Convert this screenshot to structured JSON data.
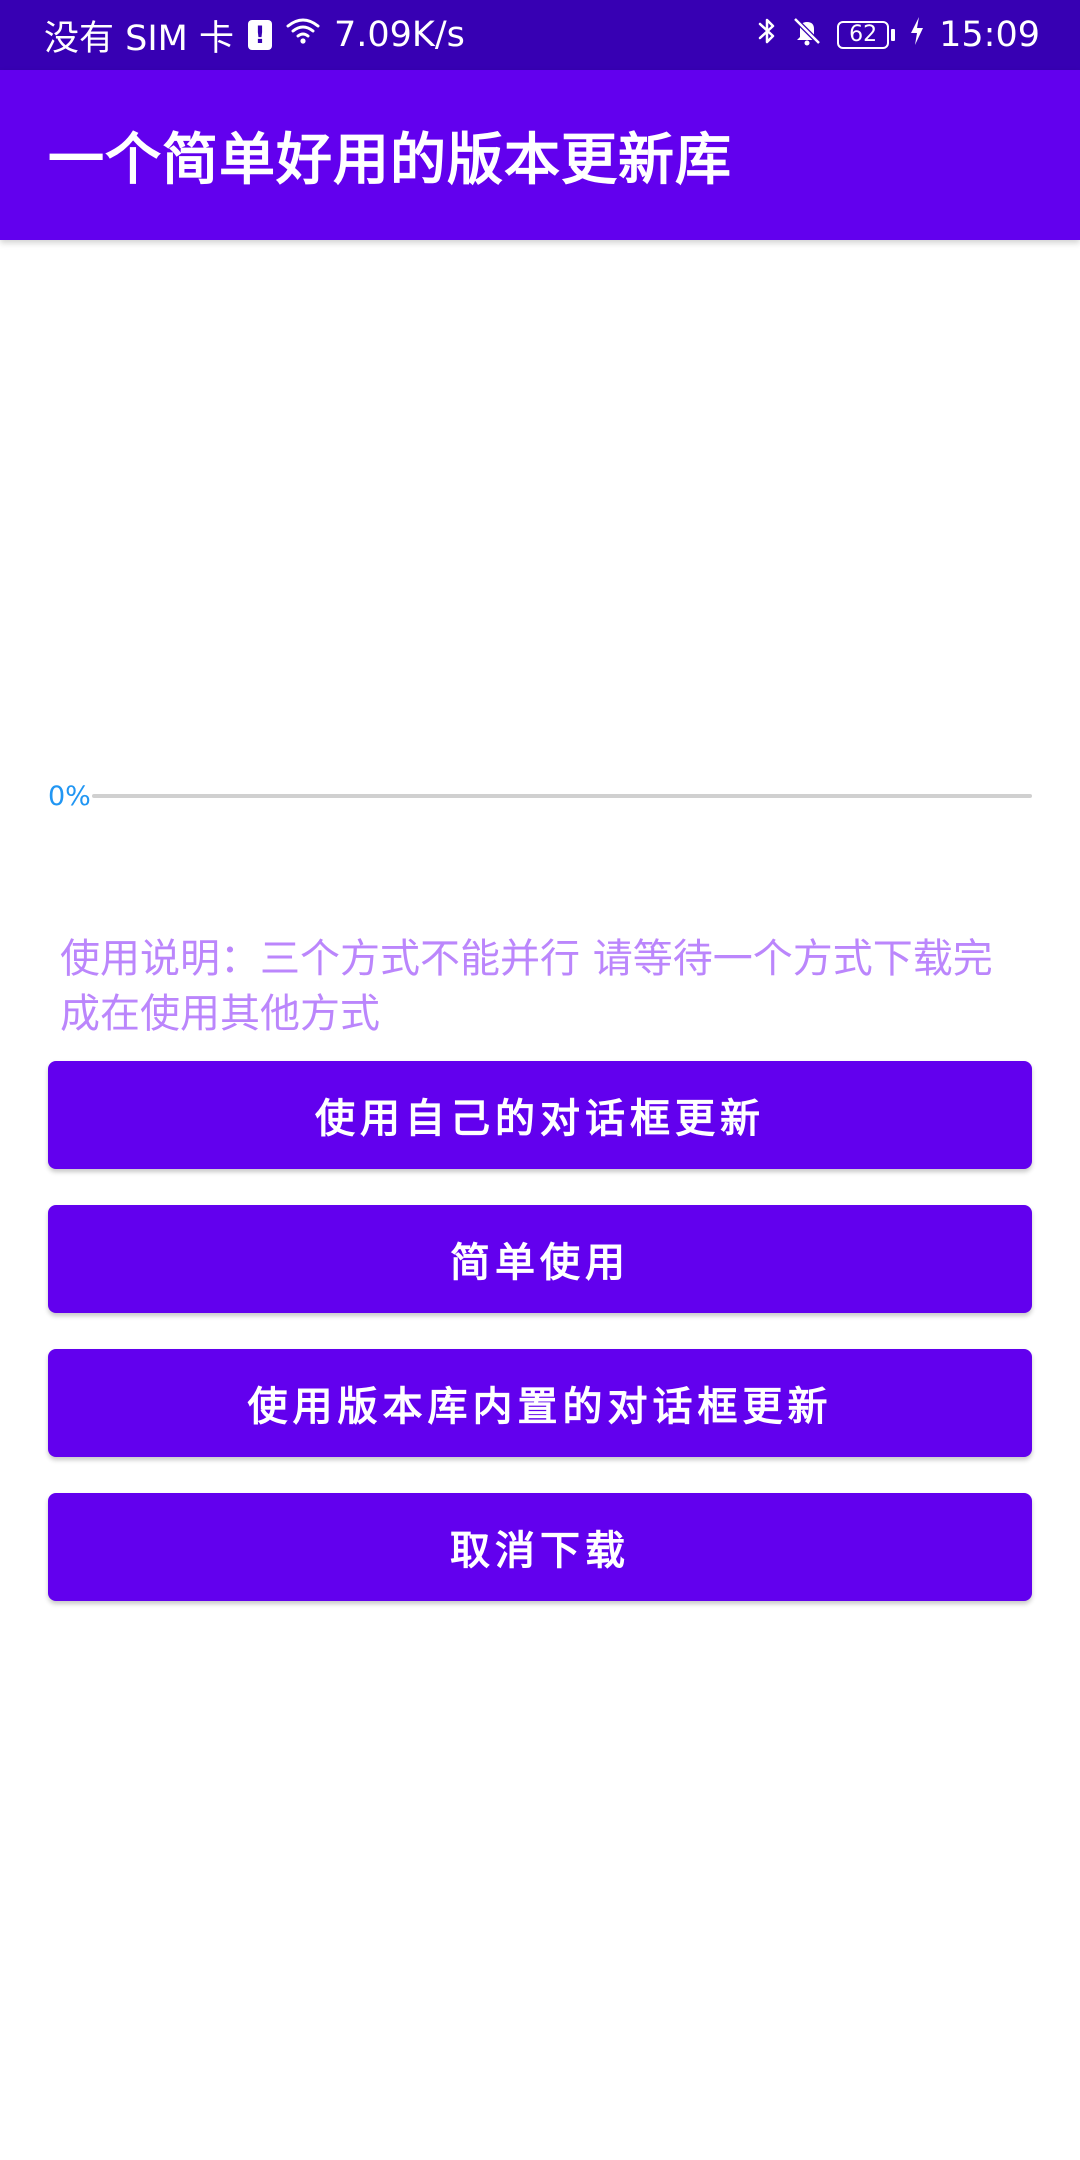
{
  "status_bar": {
    "carrier": "没有 SIM 卡",
    "sim_alert_icon": "sim-alert-icon",
    "sim_alert_glyph": "!",
    "wifi_icon": "wifi-icon",
    "network_speed": "7.09K/s",
    "bluetooth_icon": "bluetooth-icon",
    "mute_icon": "bell-off-icon",
    "battery_level": "62",
    "charging_icon": "charging-bolt-icon",
    "time": "15:09"
  },
  "app_bar": {
    "title": "一个简单好用的版本更新库"
  },
  "progress": {
    "label": "0%",
    "value": 0
  },
  "instructions": "使用说明：三个方式不能并行 请等待一个方式下载完成在使用其他方式",
  "buttons": [
    {
      "label": "使用自己的对话框更新"
    },
    {
      "label": "简单使用"
    },
    {
      "label": "使用版本库内置的对话框更新"
    },
    {
      "label": "取消下载"
    }
  ],
  "colors": {
    "status_bar": "#3700B3",
    "primary": "#6200EE",
    "accent_text": "#BB86FC",
    "progress_label": "#2196F3",
    "progress_track": "#D0D0D0"
  }
}
